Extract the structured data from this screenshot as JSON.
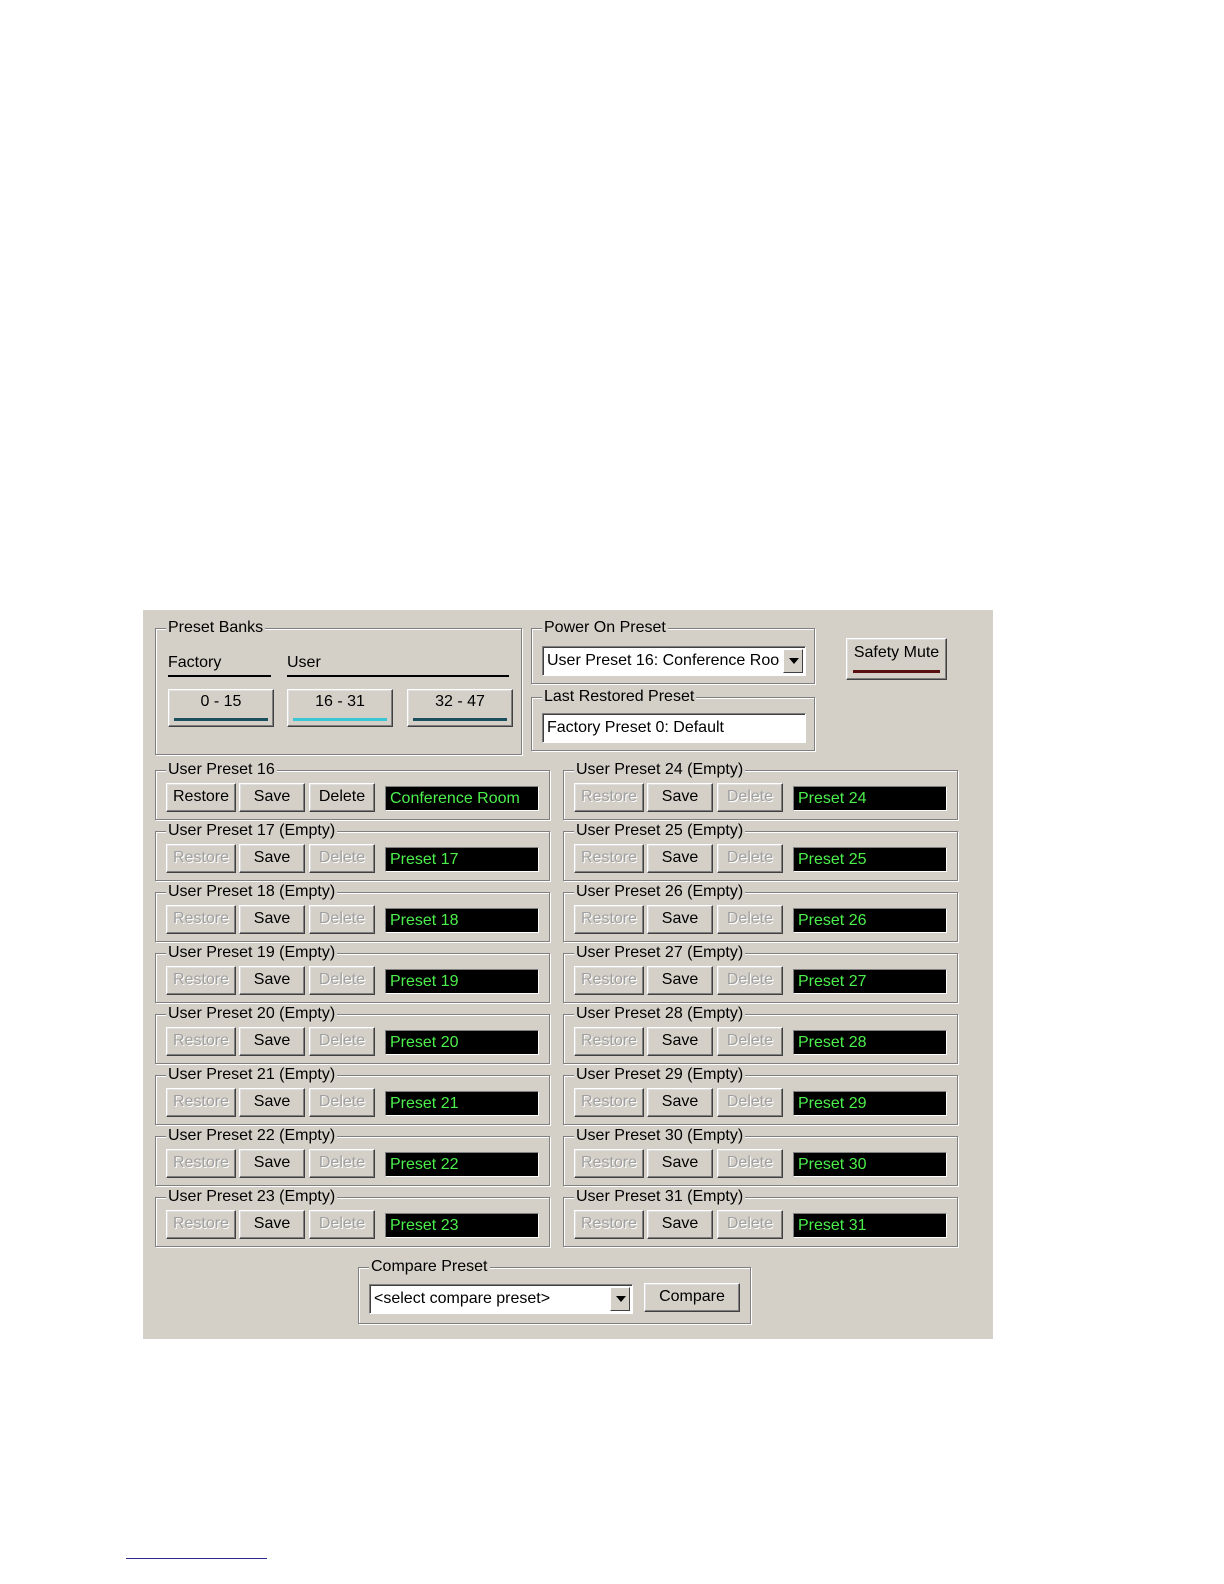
{
  "preset_banks": {
    "legend": "Preset Banks",
    "factory_label": "Factory",
    "user_label": "User",
    "banks": [
      {
        "label": "0 - 15",
        "active": false
      },
      {
        "label": "16 - 31",
        "active": true
      },
      {
        "label": "32 - 47",
        "active": false
      }
    ]
  },
  "power_on": {
    "legend": "Power On Preset",
    "value": "User Preset 16: Conference Roo"
  },
  "last_restored": {
    "legend": "Last Restored Preset",
    "value": "Factory Preset 0: Default"
  },
  "safety_mute": {
    "label": "Safety Mute"
  },
  "buttons": {
    "restore": "Restore",
    "save": "Save",
    "delete": "Delete"
  },
  "presets_left": [
    {
      "title": "User Preset 16",
      "name": "Conference Room",
      "empty": false
    },
    {
      "title": "User Preset 17 (Empty)",
      "name": "Preset 17",
      "empty": true
    },
    {
      "title": "User Preset 18 (Empty)",
      "name": "Preset 18",
      "empty": true
    },
    {
      "title": "User Preset 19 (Empty)",
      "name": "Preset 19",
      "empty": true
    },
    {
      "title": "User Preset 20 (Empty)",
      "name": "Preset 20",
      "empty": true
    },
    {
      "title": "User Preset 21 (Empty)",
      "name": "Preset 21",
      "empty": true
    },
    {
      "title": "User Preset 22 (Empty)",
      "name": "Preset 22",
      "empty": true
    },
    {
      "title": "User Preset 23 (Empty)",
      "name": "Preset 23",
      "empty": true
    }
  ],
  "presets_right": [
    {
      "title": "User Preset 24 (Empty)",
      "name": "Preset 24",
      "empty": true
    },
    {
      "title": "User Preset 25 (Empty)",
      "name": "Preset 25",
      "empty": true
    },
    {
      "title": "User Preset 26 (Empty)",
      "name": "Preset 26",
      "empty": true
    },
    {
      "title": "User Preset 27 (Empty)",
      "name": "Preset 27",
      "empty": true
    },
    {
      "title": "User Preset 28 (Empty)",
      "name": "Preset 28",
      "empty": true
    },
    {
      "title": "User Preset 29 (Empty)",
      "name": "Preset 29",
      "empty": true
    },
    {
      "title": "User Preset 30 (Empty)",
      "name": "Preset 30",
      "empty": true
    },
    {
      "title": "User Preset 31 (Empty)",
      "name": "Preset 31",
      "empty": true
    }
  ],
  "compare": {
    "legend": "Compare Preset",
    "placeholder": "<select compare preset>",
    "button": "Compare"
  }
}
